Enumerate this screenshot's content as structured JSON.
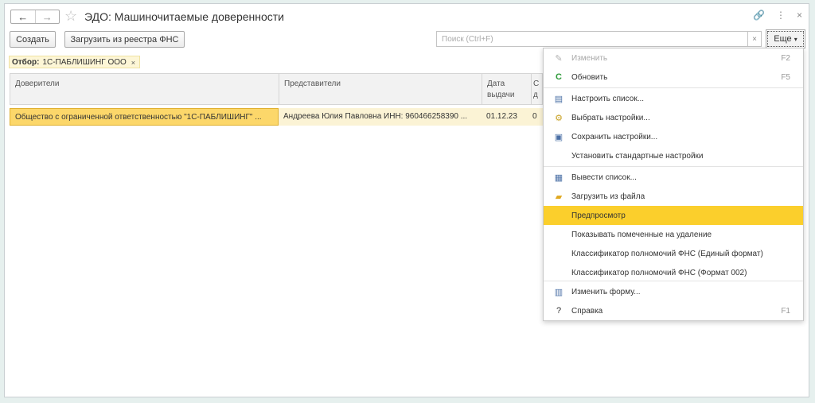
{
  "window": {
    "title": "ЭДО: Машиночитаемые доверенности",
    "nav_back": "←",
    "nav_forward": "→",
    "link_glyph": "🔗",
    "more_glyph": "⋮",
    "close_glyph": "×"
  },
  "toolbar": {
    "create_label": "Создать",
    "load_label": "Загрузить из реестра ФНС",
    "search_placeholder": "Поиск (Ctrl+F)",
    "search_clear": "×",
    "more_label": "Еще",
    "more_arrow": "▾"
  },
  "filter": {
    "prefix": "Отбор:",
    "value": "1С-ПАБЛИШИНГ ООО",
    "remove": "×"
  },
  "table": {
    "columns": [
      "Доверители",
      "Представители",
      "Дата выдачи",
      "С д"
    ],
    "rows": [
      [
        "Общество с ограниченной ответственностью \"1С-ПАБЛИШИНГ\" ...",
        "Андреева Юлия Павловна ИНН: 960466258390 ...",
        "01.12.23",
        "0"
      ]
    ]
  },
  "menu": {
    "items": [
      {
        "label": "Изменить",
        "shortcut": "F2",
        "icon": "pencil-icon",
        "glyph": "✎",
        "disabled": true
      },
      {
        "label": "Обновить",
        "shortcut": "F5",
        "icon": "refresh-icon",
        "glyph": "C",
        "color": "#2e9b3a"
      },
      {
        "label": "Настроить список...",
        "icon": "list-settings-icon",
        "glyph": "▤",
        "color": "#4a6fa5"
      },
      {
        "label": "Выбрать настройки...",
        "icon": "choose-settings-icon",
        "glyph": "⚙",
        "color": "#c9a227"
      },
      {
        "label": "Сохранить настройки...",
        "icon": "save-settings-icon",
        "glyph": "▣",
        "color": "#4a6fa5"
      },
      {
        "label": "Установить стандартные настройки"
      },
      {
        "label": "Вывести список...",
        "icon": "print-list-icon",
        "glyph": "▦",
        "color": "#4a6fa5"
      },
      {
        "label": "Загрузить из файла",
        "icon": "folder-icon",
        "glyph": "▰",
        "color": "#e0a81f"
      },
      {
        "label": "Предпросмотр",
        "highlight": true
      },
      {
        "label": "Показывать помеченные на удаление"
      },
      {
        "label": "Классификатор полномочий ФНС (Единый формат)"
      },
      {
        "label": "Классификатор полномочий ФНС (Формат 002)"
      },
      {
        "label": "Изменить форму...",
        "icon": "change-form-icon",
        "glyph": "▥",
        "color": "#4a6fa5"
      },
      {
        "label": "Справка",
        "shortcut": "F1",
        "icon": "help-icon",
        "glyph": "?",
        "color": "#333333"
      }
    ]
  },
  "colors": {
    "selected_row": "#fcd76a",
    "menu_highlight": "#fbcf2c",
    "filter_bg": "#fdf6d6"
  }
}
